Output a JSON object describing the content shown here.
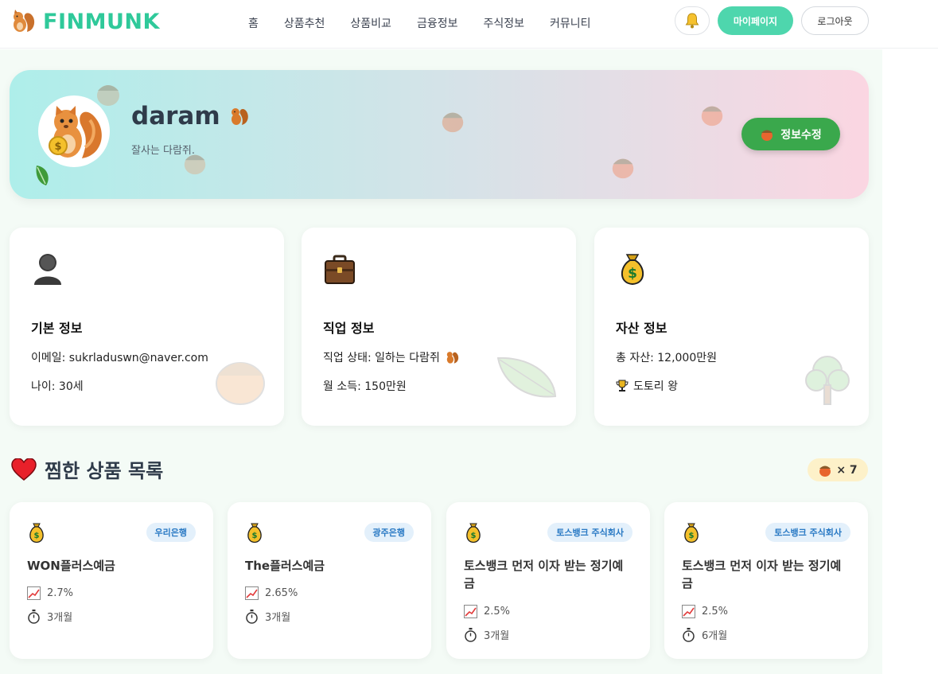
{
  "brand": {
    "name": "FINMUNK",
    "logo_icon": "squirrel-icon"
  },
  "nav": {
    "items": [
      "홈",
      "상품추천",
      "상품비교",
      "금융정보",
      "주식정보",
      "커뮤니티"
    ]
  },
  "header_actions": {
    "bell_icon": "bell-icon",
    "mypage_label": "마이페이지",
    "logout_label": "로그아웃"
  },
  "profile": {
    "username": "daram",
    "tagline": "잘사는 다람쥐.",
    "edit_label": "정보수정"
  },
  "info_cards": {
    "basic": {
      "title": "기본 정보",
      "line1": "이메일: sukrladuswn@naver.com",
      "line2": "나이: 30세"
    },
    "job": {
      "title": "직업 정보",
      "line1": "직업 상태: 일하는 다람쥐",
      "line2": "월 소득: 150만원"
    },
    "asset": {
      "title": "자산 정보",
      "line1": "총 자산: 12,000만원",
      "line2": "도토리 왕"
    }
  },
  "wishlist": {
    "title": "찜한 상품 목록",
    "count_label": "× 7",
    "products": [
      {
        "bank": "우리은행",
        "name": "WON플러스예금",
        "rate": "2.7%",
        "term": "3개월"
      },
      {
        "bank": "광주은행",
        "name": "The플러스예금",
        "rate": "2.65%",
        "term": "3개월"
      },
      {
        "bank": "토스뱅크 주식회사",
        "name": "토스뱅크 먼저 이자 받는 정기예금",
        "rate": "2.5%",
        "term": "3개월"
      },
      {
        "bank": "토스뱅크 주식회사",
        "name": "토스뱅크 먼저 이자 받는 정기예금",
        "rate": "2.5%",
        "term": "6개월"
      }
    ]
  },
  "colors": {
    "brand": "#2fc99a",
    "mypage_button": "#4ed6ad",
    "edit_button": "#3aa84c",
    "bank_badge_text": "#2979c4",
    "bank_badge_bg": "#e3f0fb"
  }
}
